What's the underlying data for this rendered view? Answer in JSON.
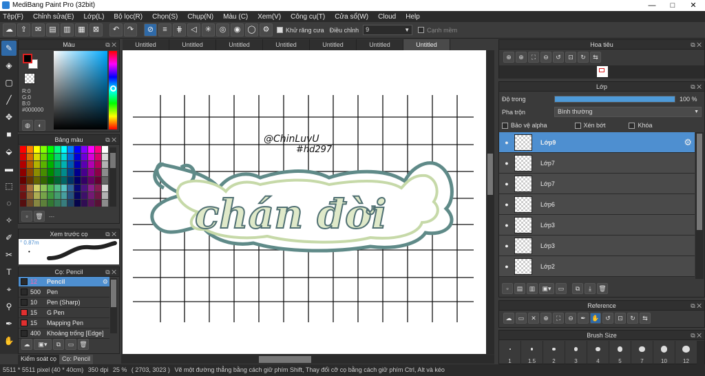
{
  "window": {
    "title": "MediBang Paint Pro (32bit)",
    "minimize": "—",
    "maximize": "□",
    "close": "✕"
  },
  "menu": [
    "Tệp(F)",
    "Chỉnh sửa(E)",
    "Lớp(L)",
    "Bộ lọc(R)",
    "Chọn(S)",
    "Chụp(N)",
    "Màu (C)",
    "Xem(V)",
    "Công cụ(T)",
    "Cửa sổ(W)",
    "Cloud",
    "Help"
  ],
  "toolbar": {
    "antialias_label": "Khử răng cưa",
    "adjust_label": "Điều chỉnh",
    "adjust_value": "9",
    "edge_label": "Cạnh mềm"
  },
  "doc_tabs": [
    "Untitled",
    "Untitled",
    "Untitled",
    "Untitled",
    "Untitled",
    "Untitled",
    "Untitled"
  ],
  "color_panel": {
    "title": "Màu",
    "r": "R:0",
    "g": "G:0",
    "b": "B:0",
    "hex": "#000000",
    "main_color": "#000000"
  },
  "palette": {
    "title": "Bảng màu",
    "extra": "---"
  },
  "preview": {
    "title": "Xem trước cọ",
    "size": "° 0.87m"
  },
  "brush_panel": {
    "title": "Cọ: Pencil",
    "brushes": [
      {
        "size": "12",
        "name": "Pencil",
        "color": "#2a2a2a"
      },
      {
        "size": "500",
        "name": "Pen",
        "color": "#2a2a2a"
      },
      {
        "size": "10",
        "name": "Pen (Sharp)",
        "color": "#2a2a2a"
      },
      {
        "size": "15",
        "name": "G Pen",
        "color": "#e03030"
      },
      {
        "size": "15",
        "name": "Mapping Pen",
        "color": "#e03030"
      },
      {
        "size": "400",
        "name": "Khoảng trống [Edge]",
        "color": "#2a2a2a"
      }
    ]
  },
  "bottom_tabs": {
    "left": "Kiểm soát cọ",
    "right": "Cọ: Pencil"
  },
  "canvas_text": {
    "line1": "@ChinLuvU",
    "line2": "#hd297",
    "main": "chán đời"
  },
  "navigator": {
    "title": "Hoa tiêu"
  },
  "layers": {
    "title": "Lớp",
    "opacity_label": "Độ trong",
    "opacity_value": "100 %",
    "opacity_fraction": 1.0,
    "blend_label": "Pha trộn",
    "blend_value": "Bình thường",
    "protect_alpha": "Bảo vệ alpha",
    "clipping": "Xén bớt",
    "lock": "Khóa",
    "items": [
      "Lớp9",
      "Lớp7",
      "Lớp7",
      "Lớp6",
      "Lớp3",
      "Lớp3",
      "Lớp2"
    ]
  },
  "reference": {
    "title": "Reference"
  },
  "brush_size": {
    "title": "Brush Size",
    "sizes": [
      "1",
      "1.5",
      "2",
      "3",
      "4",
      "5",
      "7",
      "10",
      "12"
    ]
  },
  "status": {
    "dims": "5511 * 5511 pixel",
    "cm": "(40 * 40cm)",
    "dpi": "350 dpi",
    "zoom": "25 %",
    "coords": "( 2703, 3023 )",
    "hint": "Vẽ một đường thẳng bằng cách giữ phím Shift, Thay đổi cỡ cọ bằng cách giữ phím Ctrl, Alt và kéo"
  }
}
